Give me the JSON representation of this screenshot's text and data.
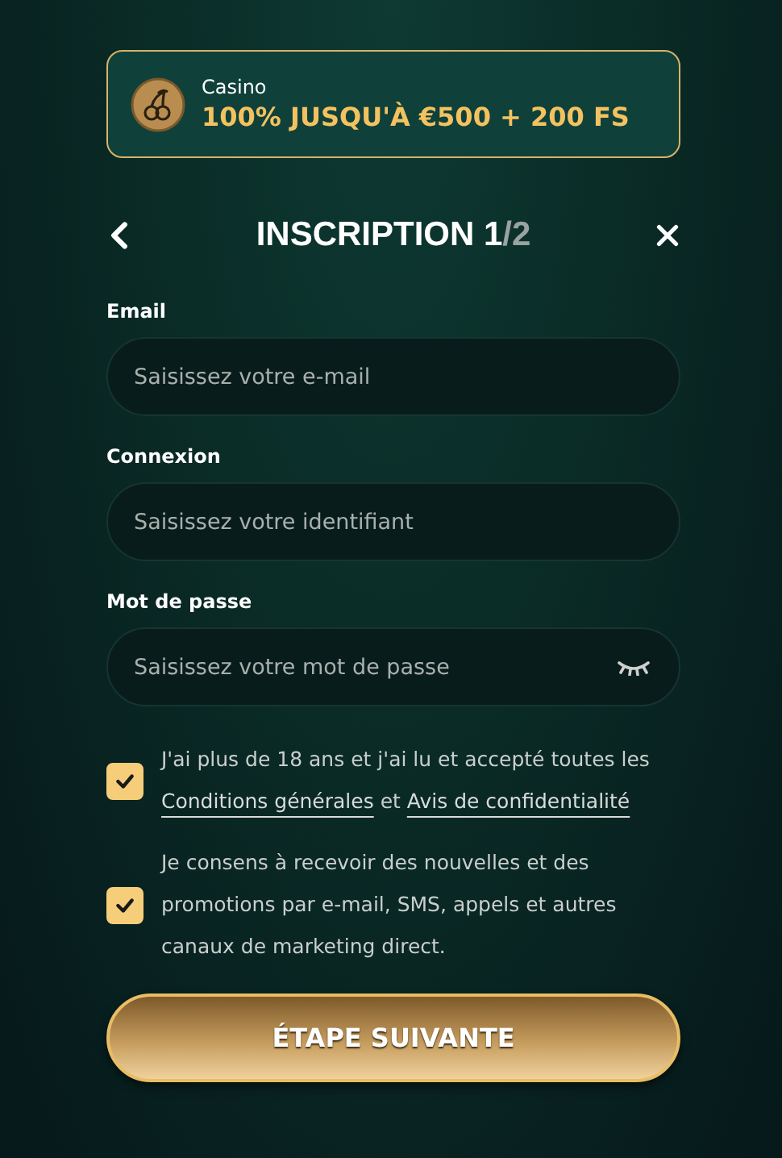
{
  "promo": {
    "label": "Casino",
    "offer": "100% JUSQU'À €500 + 200 FS"
  },
  "header": {
    "title": "INSCRIPTION 1",
    "step_suffix": "/2"
  },
  "fields": [
    {
      "label": "Email",
      "placeholder": "Saisissez votre e-mail",
      "kind": "text"
    },
    {
      "label": "Connexion",
      "placeholder": "Saisissez votre identifiant",
      "kind": "text"
    },
    {
      "label": "Mot de passe",
      "placeholder": "Saisissez votre mot de passe",
      "kind": "password"
    }
  ],
  "consents": [
    {
      "checked": true,
      "parts": [
        {
          "kind": "text",
          "text": "J'ai plus de 18 ans et j'ai lu et accepté toutes les "
        },
        {
          "kind": "link",
          "text": "Conditions générales"
        },
        {
          "kind": "text",
          "text": " et "
        },
        {
          "kind": "link",
          "text": "Avis de confidentialité"
        }
      ]
    },
    {
      "checked": true,
      "parts": [
        {
          "kind": "text",
          "text": "Je consens à recevoir des nouvelles et des promotions par e-mail, SMS, appels et autres canaux de marketing direct."
        }
      ]
    }
  ],
  "submit": "ÉTAPE SUIVANTE"
}
